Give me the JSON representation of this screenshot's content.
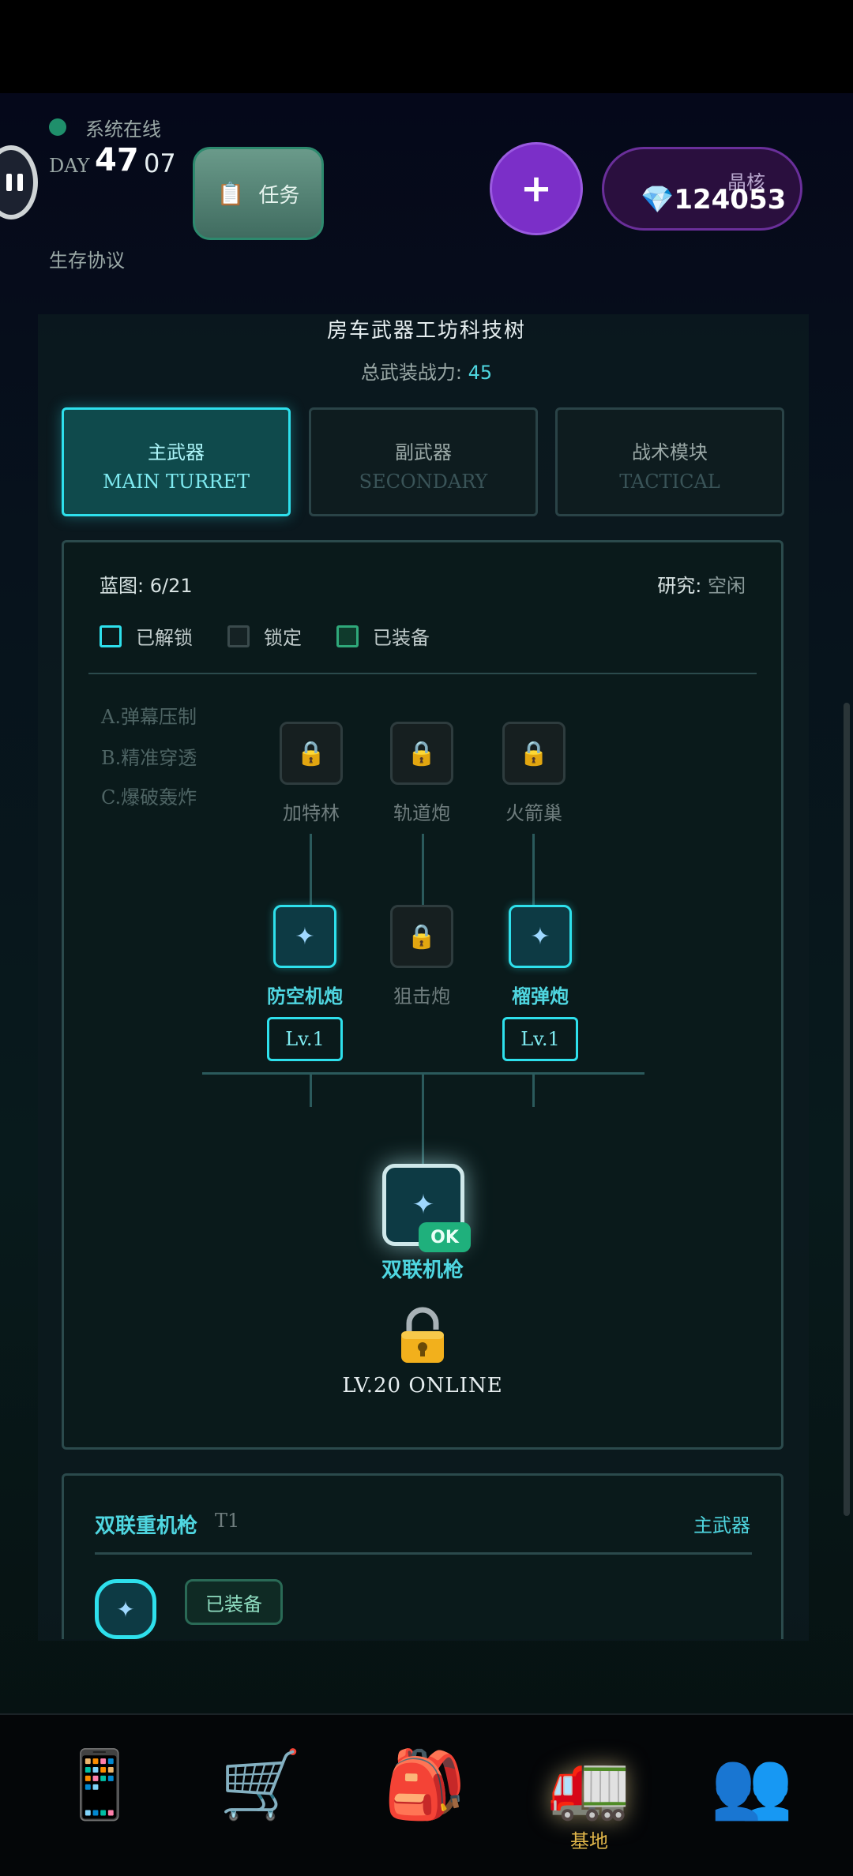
{
  "header": {
    "status_text": "系统在线",
    "day_label": "DAY",
    "day_number": "47",
    "day_hour": "07",
    "protocol": "生存协议",
    "task_label": "任务",
    "add_label": "+",
    "crystal_label": "晶核",
    "crystal_value": "💎124053"
  },
  "workshop": {
    "title": "房车武器工坊科技树",
    "power_label": "总武装战力: ",
    "power_value": "45",
    "tabs": [
      {
        "cn": "主武器",
        "en": "MAIN TURRET",
        "active": true
      },
      {
        "cn": "副武器",
        "en": "SECONDARY",
        "active": false
      },
      {
        "cn": "战术模块",
        "en": "TACTICAL",
        "active": false
      }
    ],
    "blueprint": "蓝图: 6/21",
    "research_label": "研究: ",
    "research_value": "空闲",
    "legend": [
      "已解锁",
      "锁定",
      "已装备"
    ],
    "branches": [
      "A.弹幕压制",
      "B.精准穿透",
      "C.爆破轰炸"
    ],
    "tier2": [
      "加特林",
      "轨道炮",
      "火箭巢"
    ],
    "tier1": [
      {
        "name": "防空机炮",
        "level": "Lv.1",
        "unlocked": true
      },
      {
        "name": "狙击炮",
        "level": "",
        "unlocked": false
      },
      {
        "name": "榴弹炮",
        "level": "Lv.1",
        "unlocked": true
      }
    ],
    "root": {
      "name": "双联机枪",
      "badge": "OK"
    },
    "online_label": "LV.20 ONLINE"
  },
  "detail": {
    "name": "双联重机枪",
    "tier": "T1",
    "type": "主武器",
    "equipped_label": "已装备"
  },
  "nav": {
    "items": [
      {
        "icon": "📱",
        "name": "phone"
      },
      {
        "icon": "🛒",
        "name": "shop"
      },
      {
        "icon": "🎒",
        "name": "backpack"
      },
      {
        "icon": "🚛",
        "name": "base",
        "active": true
      },
      {
        "icon": "👥",
        "name": "team"
      }
    ],
    "active_label": "基地"
  },
  "colors": {
    "accent": "#2ee0ec",
    "equipped": "#1fb07c",
    "crystal": "#7b2fc8"
  }
}
